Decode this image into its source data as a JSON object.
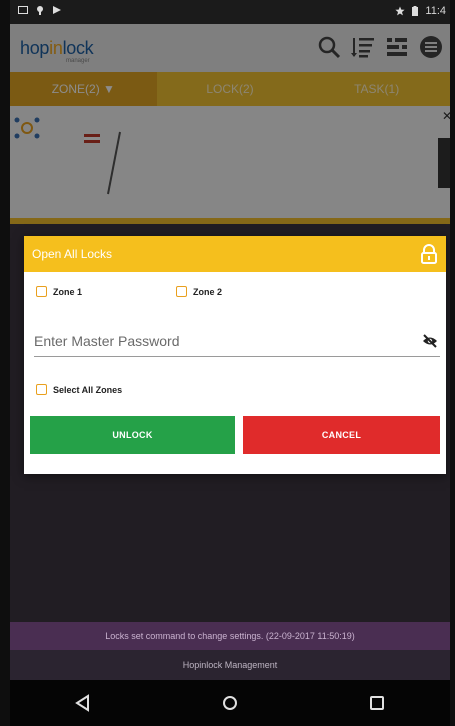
{
  "status_bar": {
    "time": "11:4"
  },
  "header": {
    "logo_text_a": "hop",
    "logo_text_b": "in",
    "logo_text_c": "lock",
    "logo_sub": "manager",
    "icons": [
      "search-icon",
      "sort-icon",
      "filter-icon",
      "menu-icon"
    ]
  },
  "tabs": [
    {
      "label": "ZONE(2) ▼",
      "active": true
    },
    {
      "label": "LOCK(2)",
      "active": false
    },
    {
      "label": "TASK(1)",
      "active": false
    }
  ],
  "dialog": {
    "title": "Open All Locks",
    "zones": [
      {
        "label": "Zone 1",
        "checked": false
      },
      {
        "label": "Zone 2",
        "checked": false
      }
    ],
    "password_placeholder": "Enter Master Password",
    "select_all_label": "Select All Zones",
    "unlock_label": "UNLOCK",
    "cancel_label": "CANCEL"
  },
  "notification": "Locks set command to change settings. (22-09-2017 11:50:19)",
  "footer": "Hopinlock Management",
  "colors": {
    "accent": "#f5bf1d",
    "tab_active": "#e1a523",
    "unlock": "#25a148",
    "cancel": "#e02b2b"
  }
}
